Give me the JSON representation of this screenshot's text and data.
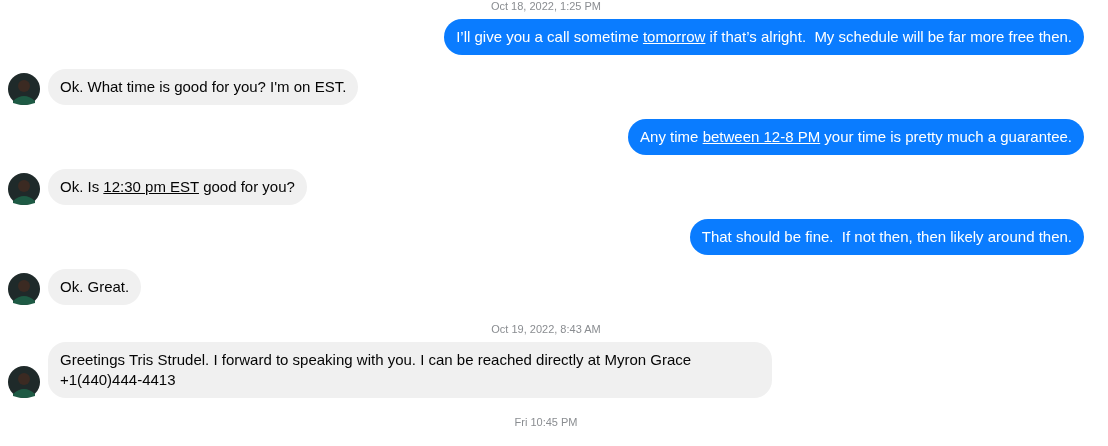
{
  "messages": [
    {
      "kind": "timestamp",
      "text": "Oct 18, 2022, 1:25 PM"
    },
    {
      "kind": "outgoing",
      "parts": [
        {
          "text": "I’ll give you a call sometime ",
          "link": false
        },
        {
          "text": "tomorrow",
          "link": true
        },
        {
          "text": " if that’s alright.  My schedule will be far more free then.",
          "link": false
        }
      ]
    },
    {
      "kind": "incoming",
      "parts": [
        {
          "text": "Ok. What time is good for you? I'm on EST.",
          "link": false
        }
      ]
    },
    {
      "kind": "outgoing",
      "parts": [
        {
          "text": "Any time ",
          "link": false
        },
        {
          "text": "between 12-8 PM",
          "link": true
        },
        {
          "text": " your time is pretty much a guarantee.",
          "link": false
        }
      ]
    },
    {
      "kind": "incoming",
      "parts": [
        {
          "text": "Ok. Is ",
          "link": false
        },
        {
          "text": "12:30 pm EST",
          "link": true
        },
        {
          "text": " good for you?",
          "link": false
        }
      ]
    },
    {
      "kind": "outgoing",
      "parts": [
        {
          "text": "That should be fine.  If not then, then likely around then.",
          "link": false
        }
      ]
    },
    {
      "kind": "incoming",
      "parts": [
        {
          "text": "Ok. Great.",
          "link": false
        }
      ]
    },
    {
      "kind": "timestamp",
      "text": "Oct 19, 2022, 8:43 AM"
    },
    {
      "kind": "incoming",
      "parts": [
        {
          "text": "Greetings Tris Strudel. I forward to speaking with you. I can be reached directly at Myron Grace +1(440)444-4413",
          "link": false
        }
      ]
    },
    {
      "kind": "timestamp",
      "text": "Fri 10:45 PM"
    }
  ]
}
